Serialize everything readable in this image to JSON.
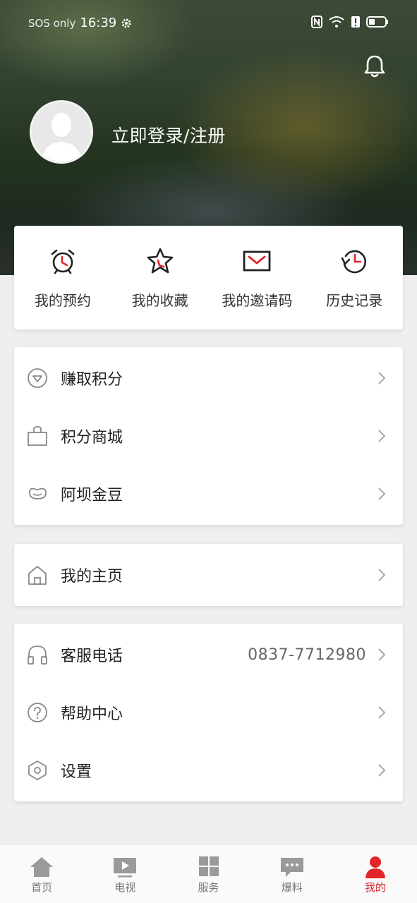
{
  "status_bar": {
    "carrier": "SOS only",
    "time": "16:39"
  },
  "profile": {
    "login_text": "立即登录/注册"
  },
  "quick_actions": [
    {
      "label": "我的预约",
      "icon": "alarm-clock-icon"
    },
    {
      "label": "我的收藏",
      "icon": "star-icon"
    },
    {
      "label": "我的邀请码",
      "icon": "envelope-icon"
    },
    {
      "label": "历史记录",
      "icon": "history-icon"
    }
  ],
  "points_menu": [
    {
      "label": "赚取积分",
      "icon": "diamond-circle-icon"
    },
    {
      "label": "积分商城",
      "icon": "shopping-bag-icon"
    },
    {
      "label": "阿坝金豆",
      "icon": "bean-icon"
    }
  ],
  "home_menu": [
    {
      "label": "我的主页",
      "icon": "house-icon"
    }
  ],
  "service_menu": [
    {
      "label": "客服电话",
      "value": "0837-7712980",
      "icon": "headset-icon"
    },
    {
      "label": "帮助中心",
      "icon": "question-circle-icon"
    },
    {
      "label": "设置",
      "icon": "hexagon-settings-icon"
    }
  ],
  "bottom_nav": [
    {
      "label": "首页",
      "icon": "home-icon"
    },
    {
      "label": "电视",
      "icon": "tv-play-icon"
    },
    {
      "label": "服务",
      "icon": "grid-icon"
    },
    {
      "label": "爆料",
      "icon": "chat-bubble-icon"
    },
    {
      "label": "我的",
      "icon": "person-icon",
      "active": true
    }
  ],
  "colors": {
    "accent": "#e0262a",
    "icon_gray": "#999999"
  }
}
